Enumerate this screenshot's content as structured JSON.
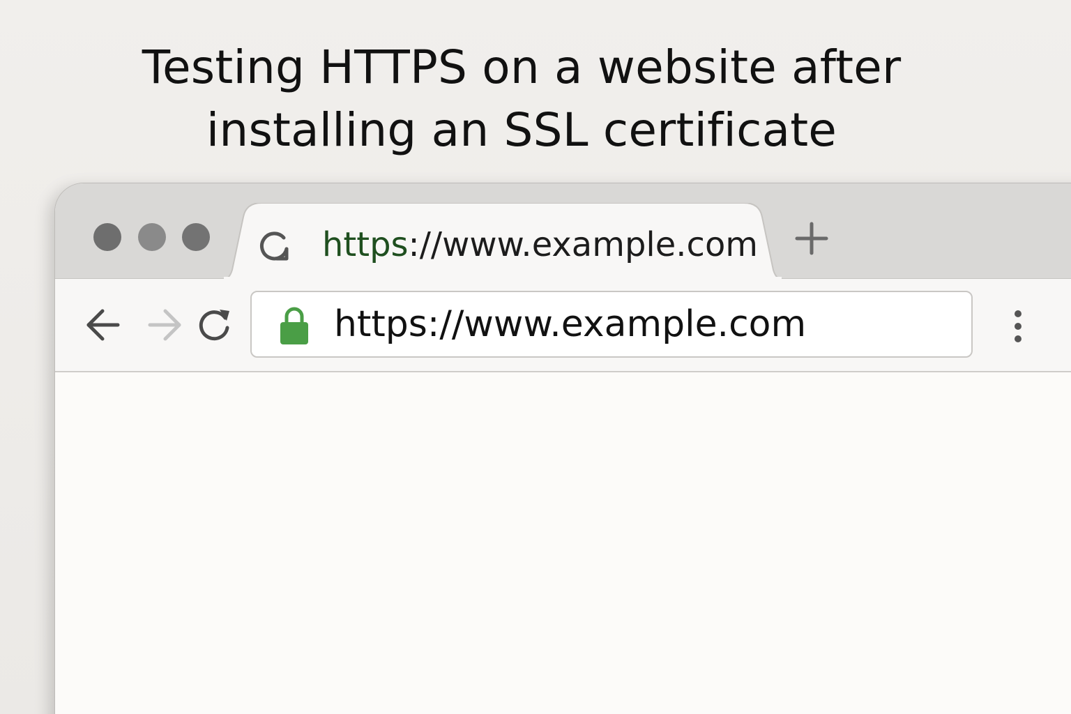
{
  "caption": {
    "line1": "Testing HTTPS on a website after",
    "line2": "installing an SSL certificate"
  },
  "browser": {
    "window_controls": [
      "close",
      "minimize",
      "maximize"
    ],
    "tab": {
      "favicon": "loading-spinner-icon",
      "title_scheme": "https",
      "title_rest": "://www.example.com"
    },
    "new_tab_icon": "plus-icon",
    "toolbar": {
      "back_icon": "arrow-left-icon",
      "forward_icon": "arrow-right-icon",
      "reload_icon": "reload-icon",
      "menu_icon": "more-vertical-icon"
    },
    "address_bar": {
      "security_icon": "lock-icon",
      "url": "https://www.example.com"
    }
  },
  "colors": {
    "lock": "#4a9e46",
    "tab_scheme_text": "#1f4f1f",
    "forward_disabled": "#c4c4c4"
  }
}
